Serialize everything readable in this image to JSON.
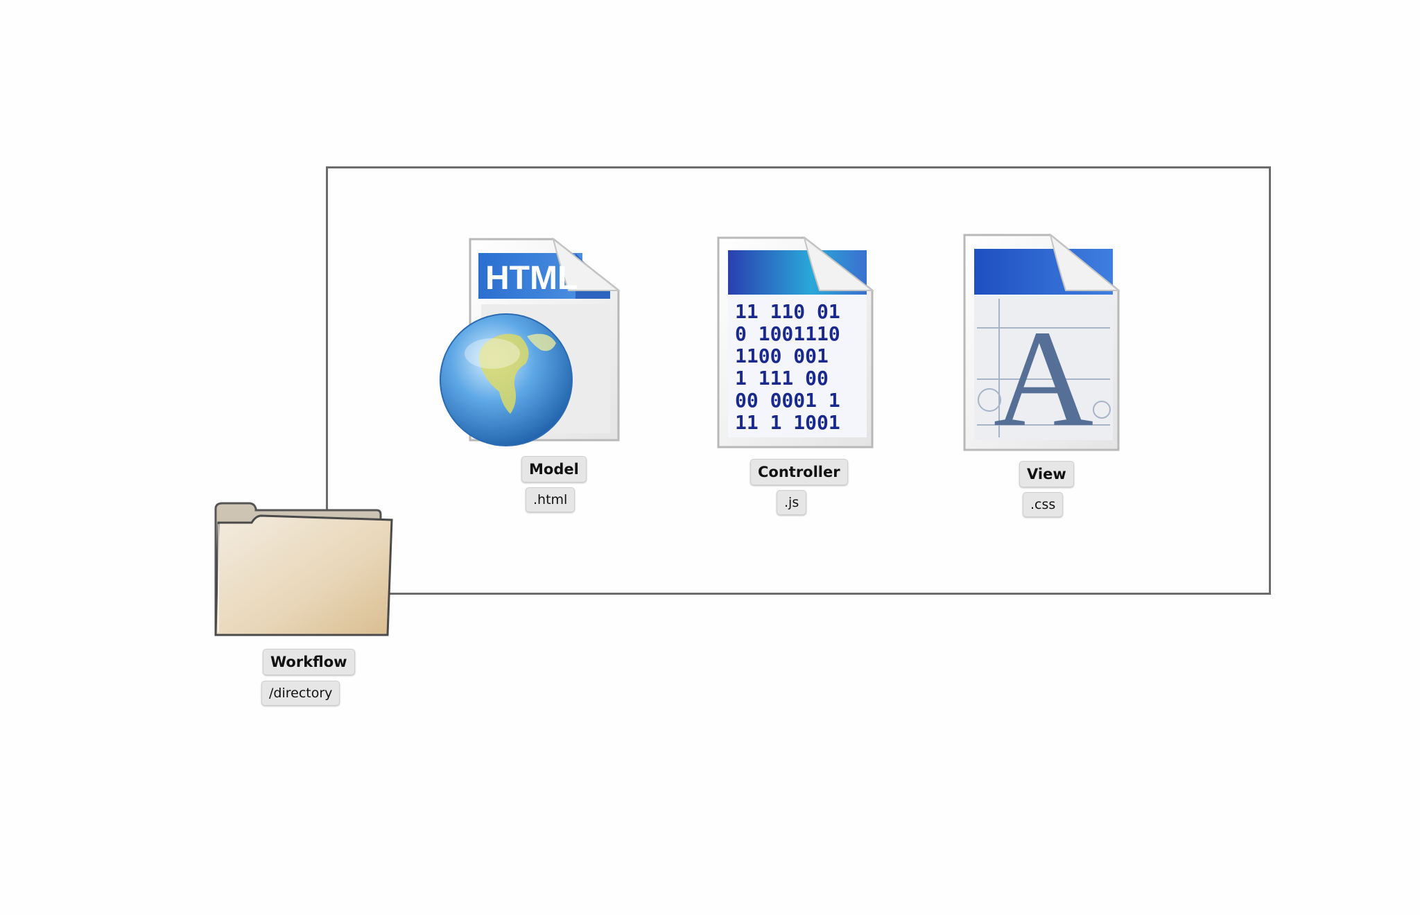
{
  "files": {
    "model": {
      "icon": "html-globe-icon",
      "badge": "HTML",
      "name": "Model",
      "ext": ".html"
    },
    "controller": {
      "icon": "binary-document-icon",
      "binary_lines": [
        "11 110 01",
        "0 1001110",
        "1100 001",
        " 1 111 00",
        "00 0001 1",
        "11 1 1001"
      ],
      "name": "Controller",
      "ext": ".js"
    },
    "view": {
      "icon": "font-document-icon",
      "glyph": "A",
      "name": "View",
      "ext": ".css"
    }
  },
  "folder": {
    "icon": "folder-icon",
    "name": "Workflow",
    "ext": "/directory"
  },
  "colors": {
    "box_border": "#6b6b6b",
    "tag_bg": "#e6e6e6",
    "folder_tan": "#dcc7a4",
    "doc_blue": "#2f6fcf",
    "binary_text": "#1a2a8c",
    "font_glyph": "#556f96"
  }
}
